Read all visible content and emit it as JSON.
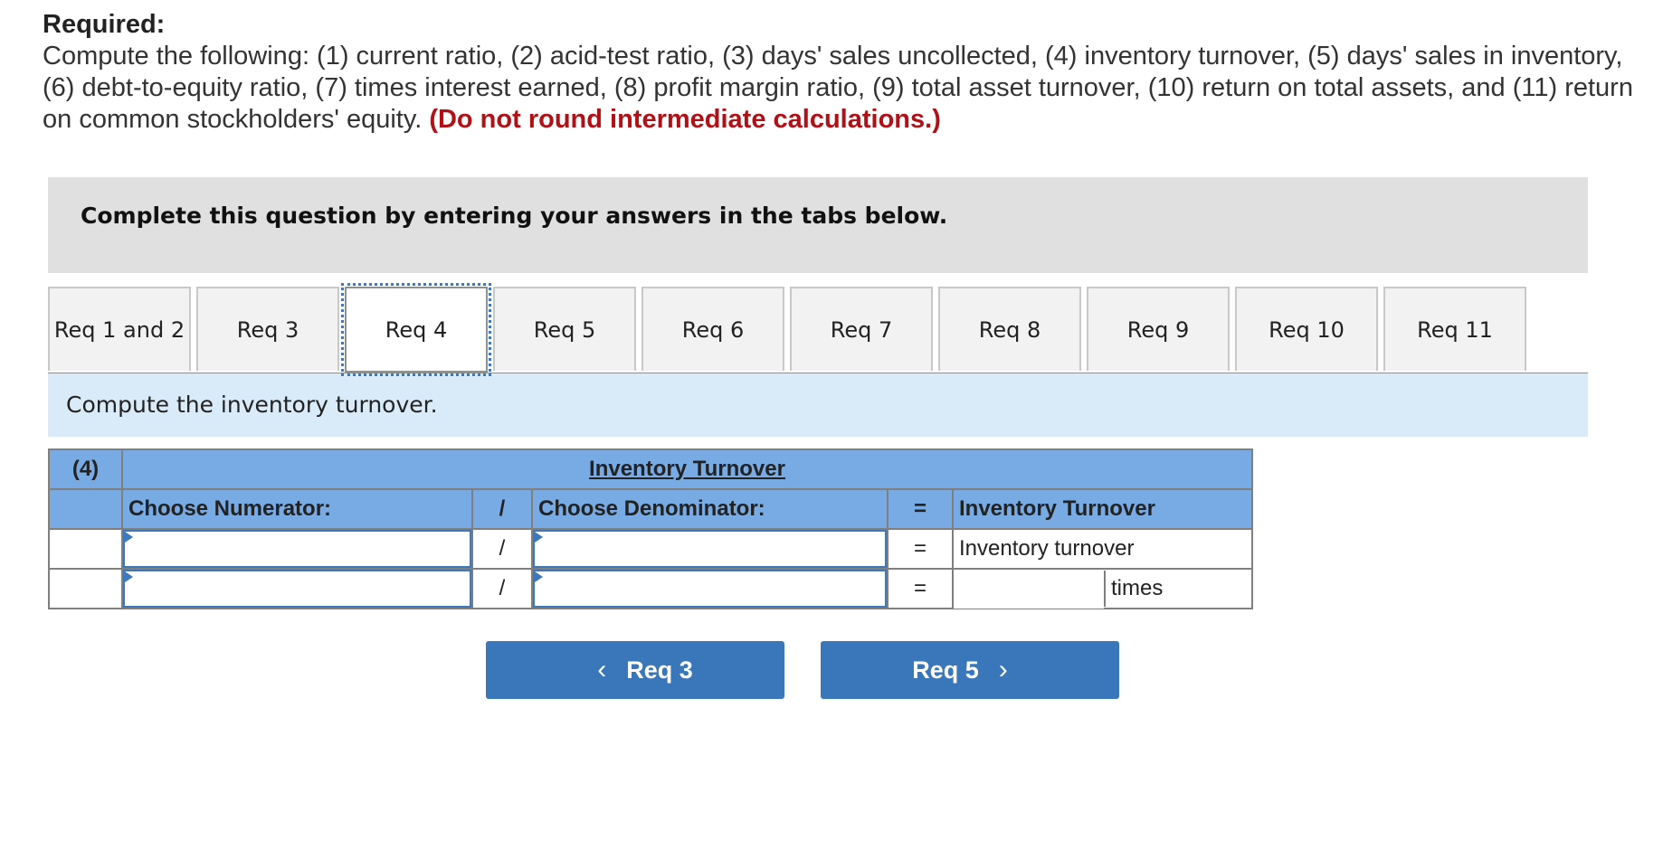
{
  "required": {
    "title": "Required:",
    "line1": "Compute the following: (1) current ratio, (2) acid-test ratio, (3) days' sales uncollected, (4) inventory turnover, (5) days' sales in inventory,",
    "line2": "(6) debt-to-equity ratio, (7) times interest earned, (8) profit margin ratio, (9) total asset turnover, (10) return on total assets, and (11) return",
    "line3": "on common stockholders' equity. ",
    "warning": "(Do not round intermediate calculations.)"
  },
  "instruction": "Complete this question by entering your answers in the tabs below.",
  "tabs": [
    {
      "label": "Req 1 and 2",
      "active": false
    },
    {
      "label": "Req 3",
      "active": false
    },
    {
      "label": "Req 4",
      "active": true
    },
    {
      "label": "Req 5",
      "active": false
    },
    {
      "label": "Req 6",
      "active": false
    },
    {
      "label": "Req 7",
      "active": false
    },
    {
      "label": "Req 8",
      "active": false
    },
    {
      "label": "Req 9",
      "active": false
    },
    {
      "label": "Req 10",
      "active": false
    },
    {
      "label": "Req 11",
      "active": false
    }
  ],
  "prompt": "Compute the inventory turnover.",
  "table": {
    "label": "(4)",
    "title": "Inventory Turnover",
    "numerator_header": "Choose Numerator:",
    "divide_op": "/",
    "denominator_header": "Choose Denominator:",
    "equals_op": "=",
    "result_header": "Inventory Turnover",
    "rows": [
      {
        "numerator": "",
        "op": "/",
        "denominator": "",
        "eq": "=",
        "result": "Inventory turnover",
        "unit": ""
      },
      {
        "numerator": "",
        "op": "/",
        "denominator": "",
        "eq": "=",
        "result": "",
        "unit": "times"
      }
    ]
  },
  "nav": {
    "prev_label": "Req 3",
    "next_label": "Req 5",
    "prev_icon": "‹",
    "next_icon": "›"
  },
  "colors": {
    "header_blue": "#78abe3",
    "button_blue": "#3a76ba",
    "warning_red": "#b01016",
    "prompt_bg": "#d9ebf9"
  }
}
